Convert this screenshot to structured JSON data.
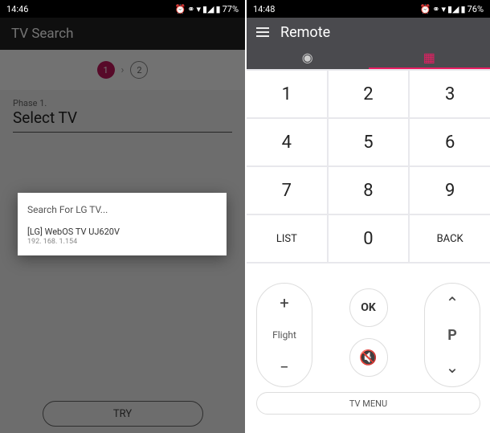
{
  "left": {
    "status": {
      "time": "14:46",
      "battery": "77%"
    },
    "app_title": "TV Search",
    "stepper": {
      "step1": "1",
      "step2": "2"
    },
    "phase_label": "Phase 1.",
    "phase_title": "Select TV",
    "dialog": {
      "title": "Search For LG TV...",
      "item_name": "[LG] WebOS TV UJ620V",
      "item_ip": "192. 168. 1.154"
    },
    "try_label": "TRY"
  },
  "right": {
    "status": {
      "time": "14:48",
      "battery": "76%"
    },
    "app_title": "Remote",
    "keys": {
      "k1": "1",
      "k2": "2",
      "k3": "3",
      "k4": "4",
      "k5": "5",
      "k6": "6",
      "k7": "7",
      "k8": "8",
      "k9": "9",
      "list": "LIST",
      "k0": "0",
      "back": "BACK"
    },
    "vol": {
      "plus": "+",
      "minus": "−",
      "label": "Flight"
    },
    "ok_label": "OK",
    "ch": {
      "up": "⌃",
      "down": "⌄",
      "label": "P"
    },
    "tvmenu": "TV MENU"
  }
}
